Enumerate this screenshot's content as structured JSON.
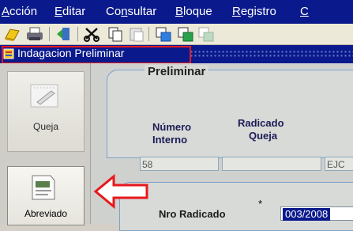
{
  "menu": {
    "items": [
      {
        "pre": "",
        "u": "A",
        "post": "cción"
      },
      {
        "pre": "",
        "u": "E",
        "post": "ditar"
      },
      {
        "pre": "Co",
        "u": "n",
        "post": "sultar"
      },
      {
        "pre": "",
        "u": "B",
        "post": "loque"
      },
      {
        "pre": "",
        "u": "R",
        "post": "egistro"
      },
      {
        "pre": "",
        "u": "C",
        "post": ""
      }
    ]
  },
  "toolbar": {
    "icons": [
      "save-icon",
      "print-icon",
      "exit-icon",
      "cut-icon",
      "copy-icon",
      "paste-icon",
      "clear-field-icon",
      "new-record-icon",
      "insert-record-icon"
    ]
  },
  "window": {
    "title": "Indagacion Preliminar"
  },
  "nav": {
    "items": [
      {
        "label": "Queja",
        "icon": "notepad-icon"
      },
      {
        "label": "Abreviado",
        "icon": "document-icon"
      }
    ]
  },
  "form": {
    "section_title": "Preliminar",
    "numero_label_1": "Número",
    "numero_label_2": "Interno",
    "radicado_queja_label_1": "Radicado",
    "radicado_queja_label_2": "Queja",
    "numero_value": "58",
    "radicado_queja_value": "",
    "third_value": "EJC",
    "nro_radicado_label": "Nro Radicado",
    "required_mark": "*",
    "nro_radicado_value": "003/2008"
  },
  "colors": {
    "titlebar": "#0a1a8c",
    "highlight_box": "#e8181d",
    "arrow": "#e8181d"
  }
}
